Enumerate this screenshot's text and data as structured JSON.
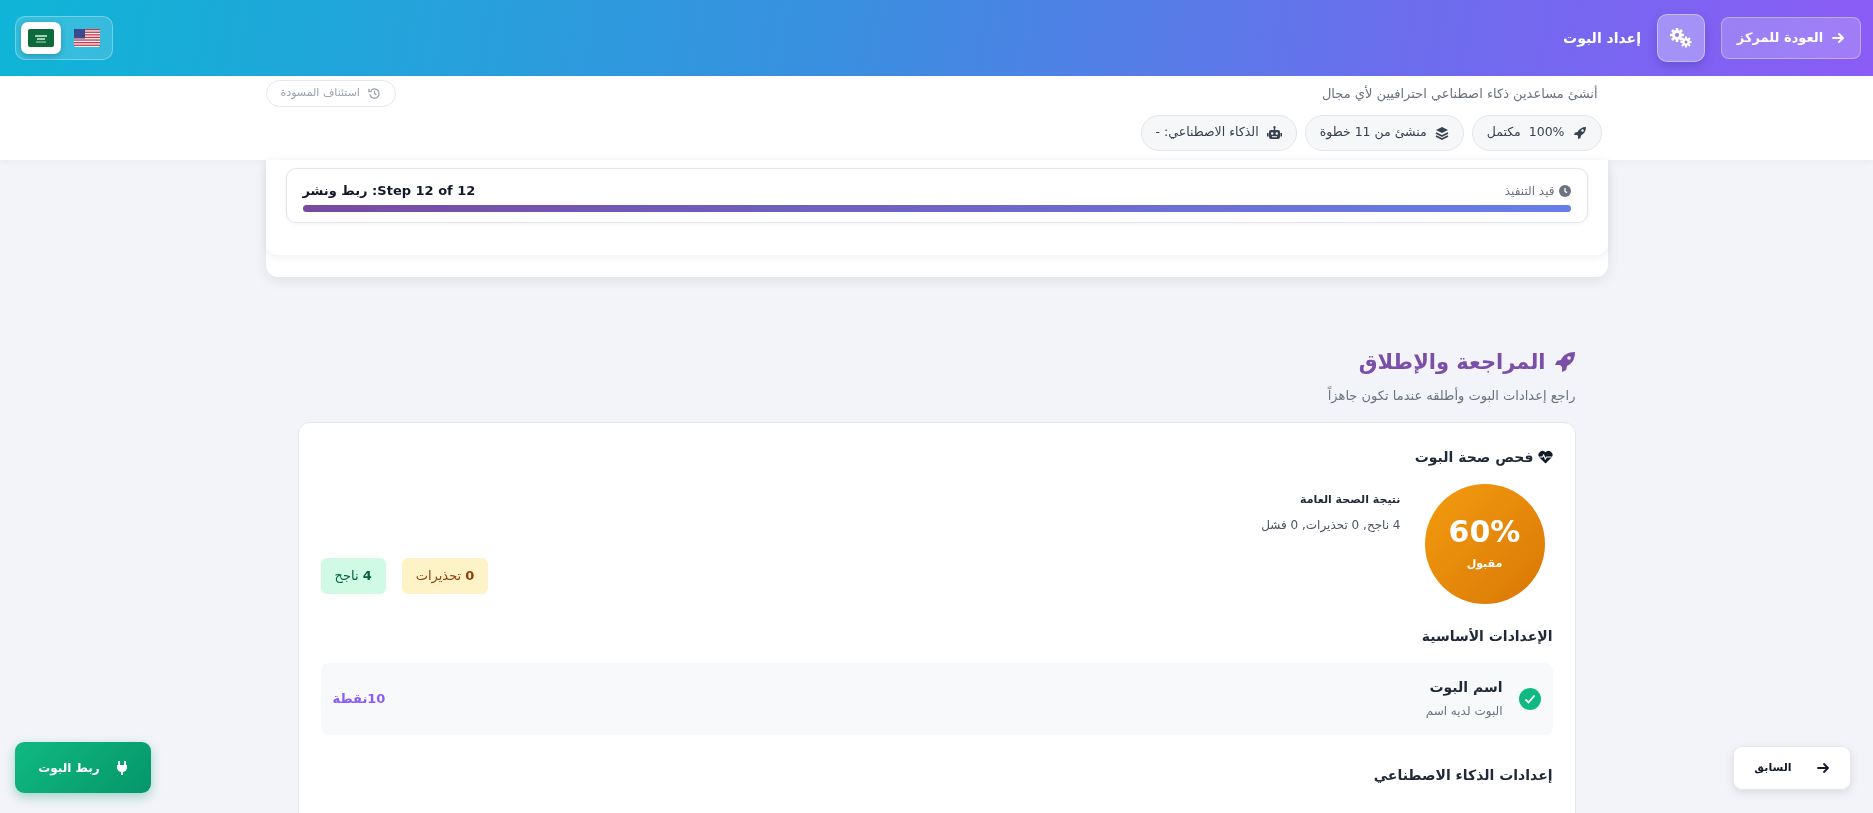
{
  "header": {
    "title": "إعداد البوت",
    "back_button": "العودة للمركز",
    "languages": [
      {
        "kind": "sa",
        "selected": true
      },
      {
        "kind": "us",
        "selected": false
      }
    ]
  },
  "intro": {
    "subtitle": "أنشئ مساعدين ذكاء اصطناعي احترافيين لأي مجال",
    "draft_button": "استئناف المسودة",
    "chips": [
      {
        "kind": "progress",
        "label": "100%  مكتمل"
      },
      {
        "kind": "steps",
        "label": "منشئ من 11 خطوة"
      },
      {
        "kind": "ai",
        "label": "الذكاء الاصطناعي: -"
      }
    ]
  },
  "progress": {
    "status": "قيد التنفيذ",
    "step": "Step 12 of 12: ربط ونشر",
    "level": 1
  },
  "review": {
    "title": "المراجعة والإطلاق",
    "subtitle": "راجع إعدادات البوت وأطلقه عندما تكون جاهزاً",
    "health": {
      "title": "فحص صحة البوت",
      "score": "60%",
      "rating": "مقبول",
      "summary_title": "نتيجة الصحة العامة",
      "summary": "4 ناجح, 0 تحذيرات, 0 فشل",
      "badges": [
        {
          "kind": "warning",
          "label": "**0** تحذيرات"
        },
        {
          "kind": "pass",
          "label": "**4** ناجح"
        }
      ]
    },
    "groups": [
      {
        "title": "الإعدادات الأساسية",
        "items": [
          {
            "name": "اسم البوت",
            "description": "البوت لديه اسم",
            "points": "10نقطة",
            "passed": true
          }
        ]
      },
      {
        "title": "إعدادات الذكاء الاصطناعي"
      }
    ]
  },
  "connect_button": "ربط البوت",
  "previous_button": "السابق"
}
